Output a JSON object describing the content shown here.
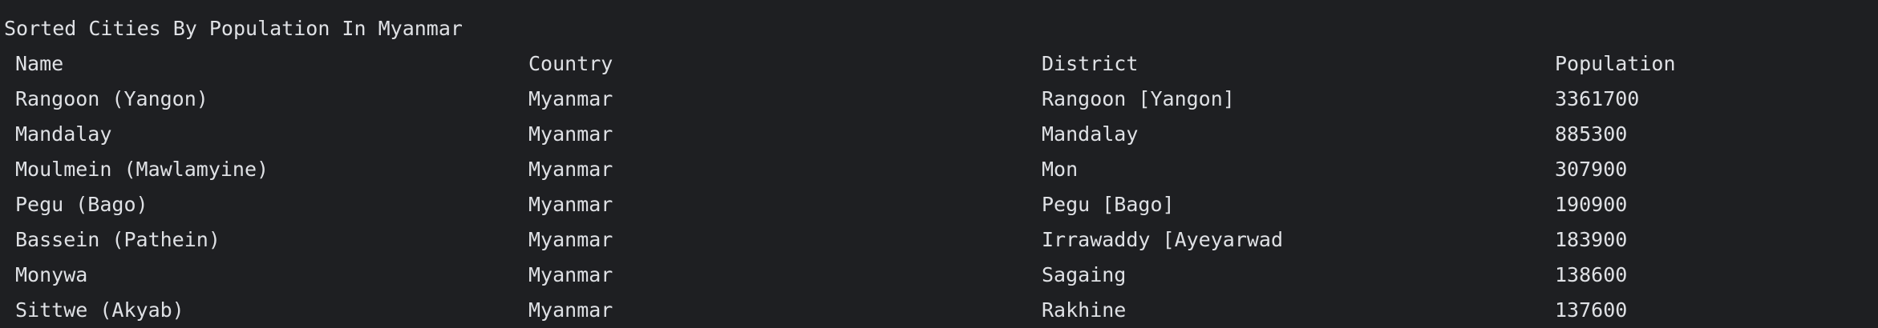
{
  "console": {
    "title": "Sorted Cities By Population In Myanmar",
    "columns": [
      "Name",
      "Country",
      "District",
      "Population"
    ],
    "rows": [
      [
        "Rangoon (Yangon)",
        "Myanmar",
        "Rangoon [Yangon]",
        "3361700"
      ],
      [
        "Mandalay",
        "Myanmar",
        "Mandalay",
        "885300"
      ],
      [
        "Moulmein (Mawlamyine)",
        "Myanmar",
        "Mon",
        "307900"
      ],
      [
        "Pegu (Bago)",
        "Myanmar",
        "Pegu [Bago]",
        "190900"
      ],
      [
        "Bassein (Pathein)",
        "Myanmar",
        "Irrawaddy [Ayeyarwad",
        "183900"
      ],
      [
        "Monywa",
        "Myanmar",
        "Sagaing",
        "138600"
      ],
      [
        "Sittwe (Akyab)",
        "Myanmar",
        "Rakhine",
        "137600"
      ]
    ]
  },
  "colors": {
    "background": "#1e1f22",
    "text": "#dfe1e5"
  }
}
